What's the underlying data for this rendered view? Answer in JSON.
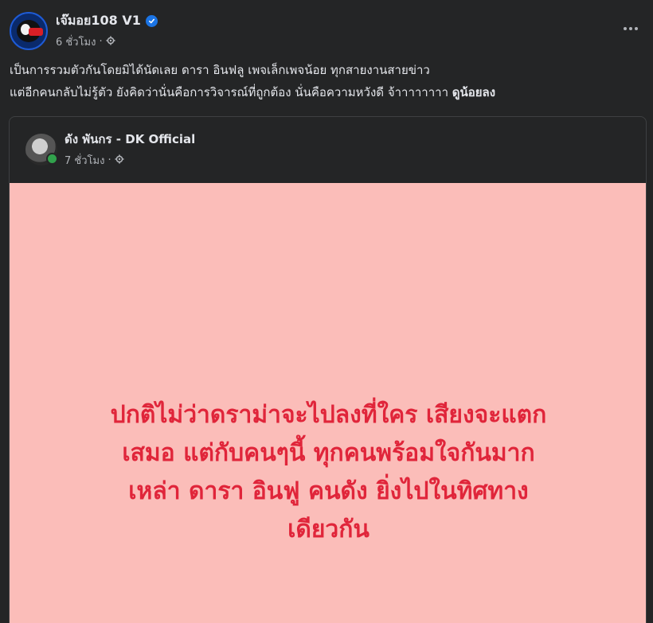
{
  "post": {
    "author": "เจ๊มอย108 V1",
    "time": "6 ชั่วโมง",
    "separator": "·",
    "text_lines": [
      "เป็นการรวมตัวกันโดยมิได้นัดเลย  ดารา อินฟลู เพจเล็กเพจน้อย  ทุกสายงานสายข่าว",
      "แต่อีกคนกลับไม่รู้ตัว ยังคิดว่านั่นคือการวิจารณ์ที่ถูกต้อง  นั่นคือความหวังดี  จ้าาาาาาาา "
    ],
    "mention": "ดูน้อยลง"
  },
  "shared_post": {
    "author": "ดัง พันกร - DK Official",
    "time": "7 ชั่วโมง",
    "separator": "·",
    "card": {
      "background": "#fbbdb9",
      "text_color": "#e0253a",
      "lines": [
        "ปกติไม่ว่าดราม่าจะไปลงที่ใคร เสียงจะแตก",
        "เสมอ แต่กับคนๆนี้ ทุกคนพร้อมใจกันมาก",
        "เหล่า ดารา อินฟู คนดัง ยิ่งไปในทิศทาง",
        "เดียวกัน"
      ]
    }
  },
  "icons": {
    "verified": "verified-badge-icon",
    "audience": "gear-icon",
    "more": "more-options-icon"
  }
}
